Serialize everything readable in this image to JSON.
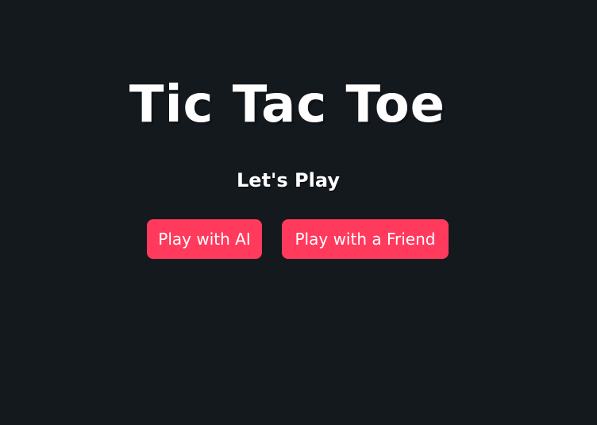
{
  "app": {
    "title": "Tic Tac Toe",
    "subtitle": "Let's Play"
  },
  "menu": {
    "play_ai_label": "Play with AI",
    "play_friend_label": "Play with a Friend"
  },
  "colors": {
    "background": "#14191e",
    "accent": "#ff3a5d",
    "text": "#ffffff"
  }
}
